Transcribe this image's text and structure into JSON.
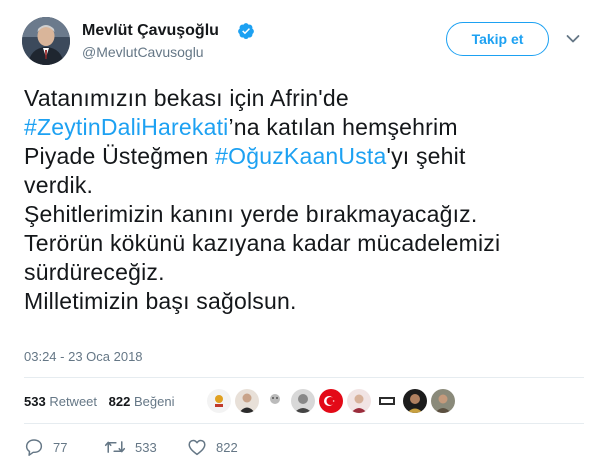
{
  "author": {
    "display_name": "Mevlüt Çavuşoğlu",
    "handle": "@MevlutCavusoglu",
    "verified": true,
    "verified_color": "#1da1f2"
  },
  "header": {
    "follow_label": "Takip et",
    "menu_icon": "chevron-down-icon"
  },
  "tweet": {
    "line1": "Vatanımızın bekası için Afrin'de",
    "hashtag1": "#ZeytinDaliHarekati",
    "line2_rest": "’na katılan hemşehrim",
    "line3_start": "Piyade Üsteğmen ",
    "hashtag2": "#OğuzKaanUsta",
    "line3_rest": "'yı şehit",
    "line4": "verdik.",
    "line5": "Şehitlerimizin kanını yerde bırakmayacağız.",
    "line6": "Terörün kökünü kazıyana kadar mücadelemizi",
    "line7": "sürdüreceğiz.",
    "line8": "Milletimizin başı sağolsun.",
    "timestamp": "03:24 - 23 Oca 2018"
  },
  "stats": {
    "retweet_count": "533",
    "retweet_label": "Retweet",
    "like_count": "822",
    "like_label": "Beğeni"
  },
  "actions": {
    "reply_count": "77",
    "retweet_count": "533",
    "like_count": "822"
  },
  "colors": {
    "accent": "#1da1f2",
    "muted": "#657786",
    "text": "#14171a"
  }
}
